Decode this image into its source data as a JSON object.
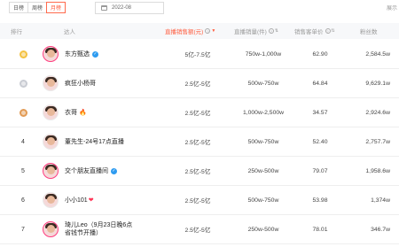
{
  "filters": {
    "tabs": [
      "日榜",
      "周榜",
      "月榜"
    ],
    "active_tab": "月榜",
    "date": "2022-08",
    "corner_text": "展示"
  },
  "columns": {
    "rank": "排行",
    "influencer": "达人",
    "sales": "直播销售额(元)",
    "volume": "直播销量(件)",
    "unit_price": "销售客单价",
    "fans": "粉丝数"
  },
  "rows": [
    {
      "rank": "1",
      "medal": "gold",
      "name": "东方甄选",
      "badge": "verified",
      "sales": "5亿-7.5亿",
      "volume": "750w-1,000w",
      "unit_price": "62.90",
      "fans": "2,584.5w"
    },
    {
      "rank": "2",
      "medal": "silver",
      "name": "疯狂小杨哥",
      "badge": "",
      "sales": "2.5亿-5亿",
      "volume": "500w-750w",
      "unit_price": "64.84",
      "fans": "9,629.1w"
    },
    {
      "rank": "3",
      "medal": "bronze",
      "name": "衣哥",
      "badge": "fire",
      "sales": "2.5亿-5亿",
      "volume": "1,000w-2,500w",
      "unit_price": "34.57",
      "fans": "2,924.6w"
    },
    {
      "rank": "4",
      "medal": "",
      "name": "董先生-24号17点直播",
      "badge": "",
      "sales": "2.5亿-5亿",
      "volume": "500w-750w",
      "unit_price": "52.40",
      "fans": "2,757.7w"
    },
    {
      "rank": "5",
      "medal": "",
      "name": "交个朋友直播间",
      "badge": "verified",
      "sales": "2.5亿-5亿",
      "volume": "250w-500w",
      "unit_price": "79.07",
      "fans": "1,958.6w"
    },
    {
      "rank": "6",
      "medal": "",
      "name": "小小101",
      "badge": "heart",
      "sales": "2.5亿-5亿",
      "volume": "500w-750w",
      "unit_price": "53.98",
      "fans": "1,374w"
    },
    {
      "rank": "7",
      "medal": "",
      "name": "琦儿Leo（9月23日晚6点省钱节开播）",
      "badge": "",
      "sales": "2.5亿-5亿",
      "volume": "250w-500w",
      "unit_price": "78.01",
      "fans": "346.7w"
    }
  ],
  "colors": {
    "accent": "#ff5a3c",
    "verified": "#2d9bf0"
  }
}
